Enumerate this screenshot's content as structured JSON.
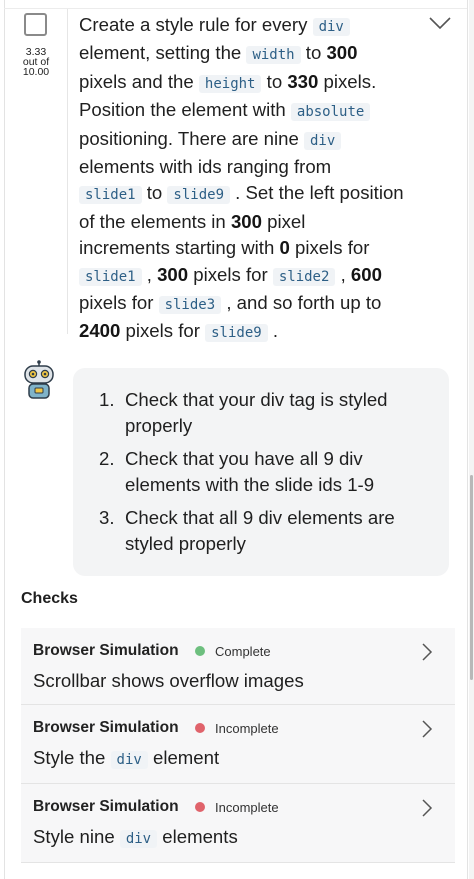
{
  "task": {
    "score_value": "3.33",
    "score_suffix": "out of",
    "score_total": "10.00",
    "lines": [
      [
        {
          "t": "Create a style rule for every "
        },
        {
          "c": "div"
        }
      ],
      [
        {
          "t": "element, setting the "
        },
        {
          "c": "width"
        },
        {
          "t": " to "
        },
        {
          "b": "300"
        }
      ],
      [
        {
          "t": "pixels and the "
        },
        {
          "c": "height"
        },
        {
          "t": " to "
        },
        {
          "b": "330"
        },
        {
          "t": " pixels."
        }
      ],
      [
        {
          "t": "Position the element with "
        },
        {
          "c": "absolute"
        }
      ],
      [
        {
          "t": "positioning. There are nine "
        },
        {
          "c": "div"
        }
      ],
      [
        {
          "t": "elements with ids ranging from"
        }
      ],
      [
        {
          "c": "slide1"
        },
        {
          "t": " to "
        },
        {
          "c": "slide9"
        },
        {
          "t": " . Set the left position"
        }
      ],
      [
        {
          "t": "of the elements in "
        },
        {
          "b": "300"
        },
        {
          "t": " pixel"
        }
      ],
      [
        {
          "t": "increments starting with "
        },
        {
          "b": "0"
        },
        {
          "t": " pixels for"
        }
      ],
      [
        {
          "c": "slide1"
        },
        {
          "t": " , "
        },
        {
          "b": "300"
        },
        {
          "t": " pixels for "
        },
        {
          "c": "slide2"
        },
        {
          "t": " , "
        },
        {
          "b": "600"
        }
      ],
      [
        {
          "t": "pixels for "
        },
        {
          "c": "slide3"
        },
        {
          "t": " , and so forth up to"
        }
      ],
      [
        {
          "b": "2400"
        },
        {
          "t": " pixels for "
        },
        {
          "c": "slide9"
        },
        {
          "t": " ."
        }
      ]
    ]
  },
  "hints": {
    "items": [
      {
        "num": "1.",
        "text": "Check that your div tag is styled properly"
      },
      {
        "num": "2.",
        "text": "Check that you have all 9 div elements with the slide ids 1-9"
      },
      {
        "num": "3.",
        "text": "Check that all 9 div elements are styled properly"
      }
    ]
  },
  "checks": {
    "title": "Checks",
    "items": [
      {
        "type": "Browser Simulation",
        "status": "Complete",
        "status_color": "#6dbf7e",
        "before": "Scrollbar shows overflow images",
        "code": "",
        "after": ""
      },
      {
        "type": "Browser Simulation",
        "status": "Incomplete",
        "status_color": "#e0636b",
        "before": "Style the ",
        "code": "div",
        "after": " element"
      },
      {
        "type": "Browser Simulation",
        "status": "Incomplete",
        "status_color": "#e0636b",
        "before": "Style nine ",
        "code": "div",
        "after": " elements"
      }
    ]
  },
  "colors": {
    "code_text": "#2d5f86",
    "code_bg": "#f0f3f6",
    "complete": "#6dbf7e",
    "incomplete": "#e0636b"
  },
  "icons": {
    "task_checkbox": "checkbox-icon",
    "expand": "chevron-down-icon",
    "assistant": "robot-icon",
    "open_check": "chevron-right-icon"
  }
}
